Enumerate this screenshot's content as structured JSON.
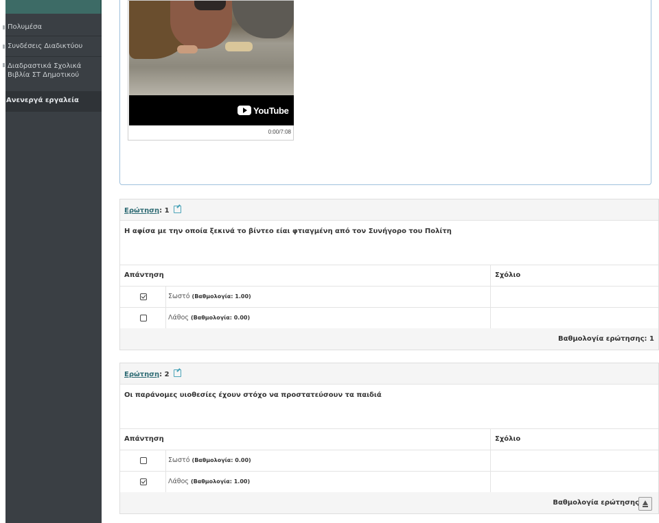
{
  "sidebar": {
    "items": [
      {
        "label": "Πολυμέσα"
      },
      {
        "label": "Συνδέσεις Διαδικτύου"
      },
      {
        "label": "Διαδραστικά Σχολικά Βιβλία ΣΤ Δημοτικού"
      }
    ],
    "section_label": "Ανενεργά εργαλεία"
  },
  "video": {
    "brand": "YouTube",
    "time": "0:00/7:08"
  },
  "questions": [
    {
      "label": "Ερώτηση",
      "number": ": 1",
      "text": "Η αφίσα με την οποία ξεκινά το βίντεο είαι φτιαγμένη από τον Συνήγορο του Πολίτη",
      "answer_header": "Απάντηση",
      "comment_header": "Σχόλιο",
      "answers": [
        {
          "label": "Σωστό",
          "score": "(Βαθμολογία: 1.00)",
          "checked": true
        },
        {
          "label": "Λάθος",
          "score": "(Βαθμολογία: 0.00)",
          "checked": false
        }
      ],
      "score_text": "Βαθμολογία ερώτησης: 1"
    },
    {
      "label": "Ερώτηση",
      "number": ": 2",
      "text": "Οι παράνομες υιοθεσίες έχουν στόχο να προστατεύσουν τα παιδιά",
      "answer_header": "Απάντηση",
      "comment_header": "Σχόλιο",
      "answers": [
        {
          "label": "Σωστό",
          "score": "(Βαθμολογία: 0.00)",
          "checked": false
        },
        {
          "label": "Λάθος",
          "score": "(Βαθμολογία: 1.00)",
          "checked": true
        }
      ],
      "score_text": "Βαθμολογία ερώτησης"
    }
  ]
}
